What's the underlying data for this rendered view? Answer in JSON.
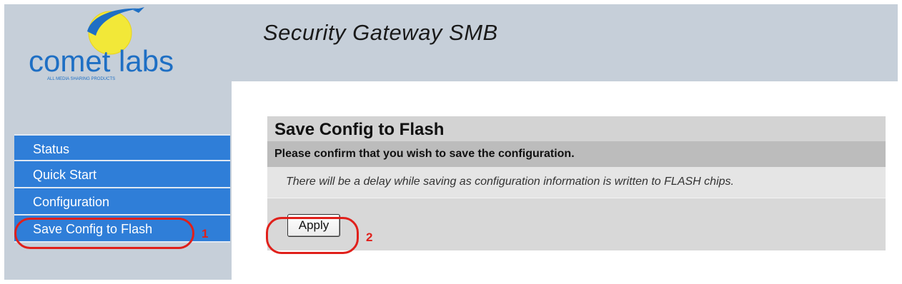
{
  "brand": {
    "name": "comet labs",
    "tagline": "ALL MEDIA SHARING PRODUCTS"
  },
  "header": {
    "title": "Security Gateway SMB"
  },
  "sidebar": {
    "items": [
      {
        "label": "Status"
      },
      {
        "label": "Quick Start"
      },
      {
        "label": "Configuration"
      },
      {
        "label": "Save Config to Flash"
      }
    ]
  },
  "panel": {
    "title": "Save Config to Flash",
    "subtitle": "Please confirm that you wish to save the configuration.",
    "note": "There will be a delay while saving as configuration information is written to FLASH chips.",
    "apply_label": "Apply"
  },
  "annotations": {
    "step1": "1",
    "step2": "2",
    "color": "#e0201b"
  },
  "colors": {
    "header_bg": "#c6cfd9",
    "nav_bg": "#2f7ed8",
    "logo_blue": "#1e6fc4",
    "logo_yellow": "#f2e838"
  }
}
